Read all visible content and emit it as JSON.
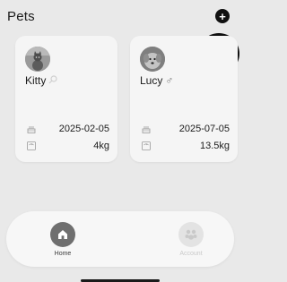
{
  "header": {
    "title": "Pets",
    "add_icon": "plus-circle-icon"
  },
  "pets": [
    {
      "name": "Kitty",
      "gender_icon": "magnifier-icon",
      "avatar": "cat-photo",
      "birth_date": "2025-02-05",
      "weight": "4kg"
    },
    {
      "name": "Lucy",
      "gender_symbol": "♂",
      "avatar": "dog-photo",
      "birth_date": "2025-07-05",
      "weight": "13.5kg"
    }
  ],
  "tabbar": {
    "home_label": "Home",
    "account_label": "Account"
  },
  "colors": {
    "background": "#e9e9e9",
    "card": "#f5f5f5",
    "accent": "#111111"
  }
}
